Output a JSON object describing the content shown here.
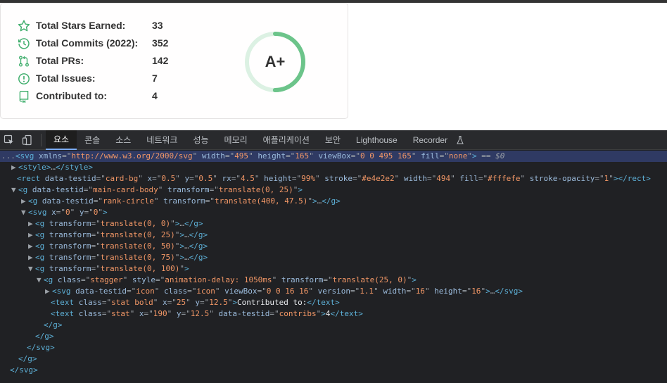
{
  "card": {
    "stats": [
      {
        "label": "Total Stars Earned:",
        "value": "33",
        "icon": "star-icon"
      },
      {
        "label": "Total Commits (2022):",
        "value": "352",
        "icon": "history-icon"
      },
      {
        "label": "Total PRs:",
        "value": "142",
        "icon": "pull-request-icon"
      },
      {
        "label": "Total Issues:",
        "value": "7",
        "icon": "issue-icon"
      },
      {
        "label": "Contributed to:",
        "value": "4",
        "icon": "repo-icon"
      }
    ],
    "rank": "A+",
    "rank_progress": 0.5,
    "colors": {
      "accent": "#6cc48a",
      "track": "#dcf1e3",
      "text": "#333333",
      "icon": "#4c71f2"
    }
  },
  "devtools": {
    "tabs": [
      "요소",
      "콘솔",
      "소스",
      "네트워크",
      "성능",
      "메모리",
      "애플리케이션",
      "보안",
      "Lighthouse",
      "Recorder"
    ],
    "active_tab": "요소",
    "lines": [
      {
        "tokens": [
          [
            "p",
            "..."
          ],
          [
            "t",
            "<svg"
          ],
          [
            "s",
            " "
          ],
          [
            "n",
            "xmlns"
          ],
          [
            "p",
            "=\""
          ],
          [
            "v",
            "http://www.w3.org/2000/svg"
          ],
          [
            "p",
            "\""
          ],
          [
            "s",
            " "
          ],
          [
            "n",
            "width"
          ],
          [
            "p",
            "=\""
          ],
          [
            "v",
            "495"
          ],
          [
            "p",
            "\""
          ],
          [
            "s",
            " "
          ],
          [
            "n",
            "height"
          ],
          [
            "p",
            "=\""
          ],
          [
            "v",
            "165"
          ],
          [
            "p",
            "\""
          ],
          [
            "s",
            " "
          ],
          [
            "n",
            "viewBox"
          ],
          [
            "p",
            "=\""
          ],
          [
            "v",
            "0 0 495 165"
          ],
          [
            "p",
            "\""
          ],
          [
            "s",
            " "
          ],
          [
            "n",
            "fill"
          ],
          [
            "p",
            "=\""
          ],
          [
            "v",
            "none"
          ],
          [
            "p",
            "\""
          ],
          [
            "t",
            ">"
          ],
          [
            "p",
            " == "
          ],
          [
            "d",
            "$0"
          ]
        ]
      },
      {
        "tokens": [
          [
            "tri",
            "▶"
          ],
          [
            "t",
            "<style>"
          ],
          [
            "p",
            "…"
          ],
          [
            "t",
            "</style>"
          ]
        ]
      },
      {
        "tokens": [
          [
            "t",
            "<rect"
          ],
          [
            "s",
            " "
          ],
          [
            "n",
            "data-testid"
          ],
          [
            "p",
            "=\""
          ],
          [
            "v",
            "card-bg"
          ],
          [
            "p",
            "\""
          ],
          [
            "s",
            " "
          ],
          [
            "n",
            "x"
          ],
          [
            "p",
            "=\""
          ],
          [
            "v",
            "0.5"
          ],
          [
            "p",
            "\""
          ],
          [
            "s",
            " "
          ],
          [
            "n",
            "y"
          ],
          [
            "p",
            "=\""
          ],
          [
            "v",
            "0.5"
          ],
          [
            "p",
            "\""
          ],
          [
            "s",
            " "
          ],
          [
            "n",
            "rx"
          ],
          [
            "p",
            "=\""
          ],
          [
            "v",
            "4.5"
          ],
          [
            "p",
            "\""
          ],
          [
            "s",
            " "
          ],
          [
            "n",
            "height"
          ],
          [
            "p",
            "=\""
          ],
          [
            "v",
            "99%"
          ],
          [
            "p",
            "\""
          ],
          [
            "s",
            " "
          ],
          [
            "n",
            "stroke"
          ],
          [
            "p",
            "=\""
          ],
          [
            "v",
            "#e4e2e2"
          ],
          [
            "p",
            "\""
          ],
          [
            "s",
            " "
          ],
          [
            "n",
            "width"
          ],
          [
            "p",
            "=\""
          ],
          [
            "v",
            "494"
          ],
          [
            "p",
            "\""
          ],
          [
            "s",
            " "
          ],
          [
            "n",
            "fill"
          ],
          [
            "p",
            "=\""
          ],
          [
            "v",
            "#fffefe"
          ],
          [
            "p",
            "\""
          ],
          [
            "s",
            " "
          ],
          [
            "n",
            "stroke-opacity"
          ],
          [
            "p",
            "=\""
          ],
          [
            "v",
            "1"
          ],
          [
            "p",
            "\""
          ],
          [
            "t",
            "></rect>"
          ]
        ]
      },
      {
        "tokens": [
          [
            "tri",
            "▼"
          ],
          [
            "t",
            "<g"
          ],
          [
            "s",
            " "
          ],
          [
            "n",
            "data-testid"
          ],
          [
            "p",
            "=\""
          ],
          [
            "v",
            "main-card-body"
          ],
          [
            "p",
            "\""
          ],
          [
            "s",
            " "
          ],
          [
            "n",
            "transform"
          ],
          [
            "p",
            "=\""
          ],
          [
            "v",
            "translate(0, 25)"
          ],
          [
            "p",
            "\""
          ],
          [
            "t",
            ">"
          ]
        ]
      },
      {
        "tokens": [
          [
            "tri",
            "▶"
          ],
          [
            "t",
            "<g"
          ],
          [
            "s",
            " "
          ],
          [
            "n",
            "data-testid"
          ],
          [
            "p",
            "=\""
          ],
          [
            "v",
            "rank-circle"
          ],
          [
            "p",
            "\""
          ],
          [
            "s",
            " "
          ],
          [
            "n",
            "transform"
          ],
          [
            "p",
            "=\""
          ],
          [
            "v",
            "translate(400, 47.5)"
          ],
          [
            "p",
            "\""
          ],
          [
            "t",
            ">"
          ],
          [
            "p",
            "…"
          ],
          [
            "t",
            "</g>"
          ]
        ]
      },
      {
        "tokens": [
          [
            "tri",
            "▼"
          ],
          [
            "t",
            "<svg"
          ],
          [
            "s",
            " "
          ],
          [
            "n",
            "x"
          ],
          [
            "p",
            "=\""
          ],
          [
            "v",
            "0"
          ],
          [
            "p",
            "\""
          ],
          [
            "s",
            " "
          ],
          [
            "n",
            "y"
          ],
          [
            "p",
            "=\""
          ],
          [
            "v",
            "0"
          ],
          [
            "p",
            "\""
          ],
          [
            "t",
            ">"
          ]
        ]
      },
      {
        "tokens": [
          [
            "tri",
            "▶"
          ],
          [
            "t",
            "<g"
          ],
          [
            "s",
            " "
          ],
          [
            "n",
            "transform"
          ],
          [
            "p",
            "=\""
          ],
          [
            "v",
            "translate(0, 0)"
          ],
          [
            "p",
            "\""
          ],
          [
            "t",
            ">"
          ],
          [
            "p",
            "…"
          ],
          [
            "t",
            "</g>"
          ]
        ]
      },
      {
        "tokens": [
          [
            "tri",
            "▶"
          ],
          [
            "t",
            "<g"
          ],
          [
            "s",
            " "
          ],
          [
            "n",
            "transform"
          ],
          [
            "p",
            "=\""
          ],
          [
            "v",
            "translate(0, 25)"
          ],
          [
            "p",
            "\""
          ],
          [
            "t",
            ">"
          ],
          [
            "p",
            "…"
          ],
          [
            "t",
            "</g>"
          ]
        ]
      },
      {
        "tokens": [
          [
            "tri",
            "▶"
          ],
          [
            "t",
            "<g"
          ],
          [
            "s",
            " "
          ],
          [
            "n",
            "transform"
          ],
          [
            "p",
            "=\""
          ],
          [
            "v",
            "translate(0, 50)"
          ],
          [
            "p",
            "\""
          ],
          [
            "t",
            ">"
          ],
          [
            "p",
            "…"
          ],
          [
            "t",
            "</g>"
          ]
        ]
      },
      {
        "tokens": [
          [
            "tri",
            "▶"
          ],
          [
            "t",
            "<g"
          ],
          [
            "s",
            " "
          ],
          [
            "n",
            "transform"
          ],
          [
            "p",
            "=\""
          ],
          [
            "v",
            "translate(0, 75)"
          ],
          [
            "p",
            "\""
          ],
          [
            "t",
            ">"
          ],
          [
            "p",
            "…"
          ],
          [
            "t",
            "</g>"
          ]
        ]
      },
      {
        "tokens": [
          [
            "tri",
            "▼"
          ],
          [
            "t",
            "<g"
          ],
          [
            "s",
            " "
          ],
          [
            "n",
            "transform"
          ],
          [
            "p",
            "=\""
          ],
          [
            "v",
            "translate(0, 100)"
          ],
          [
            "p",
            "\""
          ],
          [
            "t",
            ">"
          ]
        ]
      },
      {
        "tokens": [
          [
            "tri",
            "▼"
          ],
          [
            "t",
            "<g"
          ],
          [
            "s",
            " "
          ],
          [
            "n",
            "class"
          ],
          [
            "p",
            "=\""
          ],
          [
            "v",
            "stagger"
          ],
          [
            "p",
            "\""
          ],
          [
            "s",
            " "
          ],
          [
            "n",
            "style"
          ],
          [
            "p",
            "=\""
          ],
          [
            "v",
            "animation-delay: 1050ms"
          ],
          [
            "p",
            "\""
          ],
          [
            "s",
            " "
          ],
          [
            "n",
            "transform"
          ],
          [
            "p",
            "=\""
          ],
          [
            "v",
            "translate(25, 0)"
          ],
          [
            "p",
            "\""
          ],
          [
            "t",
            ">"
          ]
        ]
      },
      {
        "tokens": [
          [
            "tri",
            "▶"
          ],
          [
            "t",
            "<svg"
          ],
          [
            "s",
            " "
          ],
          [
            "n",
            "data-testid"
          ],
          [
            "p",
            "=\""
          ],
          [
            "v",
            "icon"
          ],
          [
            "p",
            "\""
          ],
          [
            "s",
            " "
          ],
          [
            "n",
            "class"
          ],
          [
            "p",
            "=\""
          ],
          [
            "v",
            "icon"
          ],
          [
            "p",
            "\""
          ],
          [
            "s",
            " "
          ],
          [
            "n",
            "viewBox"
          ],
          [
            "p",
            "=\""
          ],
          [
            "v",
            "0 0 16 16"
          ],
          [
            "p",
            "\""
          ],
          [
            "s",
            " "
          ],
          [
            "n",
            "version"
          ],
          [
            "p",
            "=\""
          ],
          [
            "v",
            "1.1"
          ],
          [
            "p",
            "\""
          ],
          [
            "s",
            " "
          ],
          [
            "n",
            "width"
          ],
          [
            "p",
            "=\""
          ],
          [
            "v",
            "16"
          ],
          [
            "p",
            "\""
          ],
          [
            "s",
            " "
          ],
          [
            "n",
            "height"
          ],
          [
            "p",
            "=\""
          ],
          [
            "v",
            "16"
          ],
          [
            "p",
            "\""
          ],
          [
            "t",
            ">"
          ],
          [
            "p",
            "…"
          ],
          [
            "t",
            "</svg>"
          ]
        ]
      },
      {
        "tokens": [
          [
            "t",
            "<text"
          ],
          [
            "s",
            " "
          ],
          [
            "n",
            "class"
          ],
          [
            "p",
            "=\""
          ],
          [
            "v",
            "stat bold"
          ],
          [
            "p",
            "\""
          ],
          [
            "s",
            " "
          ],
          [
            "n",
            "x"
          ],
          [
            "p",
            "=\""
          ],
          [
            "v",
            "25"
          ],
          [
            "p",
            "\""
          ],
          [
            "s",
            " "
          ],
          [
            "n",
            "y"
          ],
          [
            "p",
            "=\""
          ],
          [
            "v",
            "12.5"
          ],
          [
            "p",
            "\""
          ],
          [
            "t",
            ">"
          ],
          [
            "x",
            "Contributed to:"
          ],
          [
            "t",
            "</text>"
          ]
        ]
      },
      {
        "tokens": [
          [
            "t",
            "<text"
          ],
          [
            "s",
            " "
          ],
          [
            "n",
            "class"
          ],
          [
            "p",
            "=\""
          ],
          [
            "v",
            "stat"
          ],
          [
            "p",
            "\""
          ],
          [
            "s",
            " "
          ],
          [
            "n",
            "x"
          ],
          [
            "p",
            "=\""
          ],
          [
            "v",
            "190"
          ],
          [
            "p",
            "\""
          ],
          [
            "s",
            " "
          ],
          [
            "n",
            "y"
          ],
          [
            "p",
            "=\""
          ],
          [
            "v",
            "12.5"
          ],
          [
            "p",
            "\""
          ],
          [
            "s",
            " "
          ],
          [
            "n",
            "data-testid"
          ],
          [
            "p",
            "=\""
          ],
          [
            "v",
            "contribs"
          ],
          [
            "p",
            "\""
          ],
          [
            "t",
            ">"
          ],
          [
            "x",
            "4"
          ],
          [
            "t",
            "</text>"
          ]
        ]
      },
      {
        "tokens": [
          [
            "t",
            "</g>"
          ]
        ]
      },
      {
        "tokens": [
          [
            "t",
            "</g>"
          ]
        ]
      },
      {
        "tokens": [
          [
            "t",
            "</svg>"
          ]
        ]
      },
      {
        "tokens": [
          [
            "t",
            "</g>"
          ]
        ]
      },
      {
        "tokens": [
          [
            "t",
            "</svg>"
          ]
        ]
      }
    ]
  }
}
